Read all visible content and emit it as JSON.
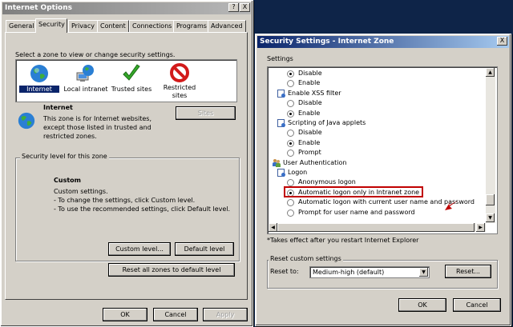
{
  "left_window": {
    "title": "Internet Options",
    "title_buttons": [
      "?",
      "X"
    ],
    "tabs": [
      "General",
      "Security",
      "Privacy",
      "Content",
      "Connections",
      "Programs",
      "Advanced"
    ],
    "zone_prompt": "Select a zone to view or change security settings.",
    "zones": [
      {
        "label": "Internet",
        "icon": "globe-icon"
      },
      {
        "label": "Local intranet",
        "icon": "intranet-icon"
      },
      {
        "label": "Trusted sites",
        "icon": "checkmark-icon"
      },
      {
        "label": "Restricted sites",
        "icon": "restricted-icon"
      }
    ],
    "zone_title": "Internet",
    "zone_desc": [
      "This zone is for Internet websites,",
      "except those listed in trusted and",
      "restricted zones."
    ],
    "sites_button": "Sites",
    "level_group_label": "Security level for this zone",
    "custom_title": "Custom",
    "custom_lines": [
      "Custom settings.",
      "- To change the settings, click Custom level.",
      "- To use the recommended settings, click Default level."
    ],
    "custom_level_button": "Custom level...",
    "default_level_button": "Default level",
    "reset_all_button": "Reset all zones to default level",
    "ok": "OK",
    "cancel": "Cancel",
    "apply": "Apply"
  },
  "right_window": {
    "title": "Security Settings - Internet Zone",
    "close": "X",
    "settings_label": "Settings",
    "items": [
      {
        "kind": "radio",
        "label": "Disable",
        "checked": true
      },
      {
        "kind": "radio",
        "label": "Enable",
        "checked": false
      },
      {
        "kind": "header",
        "label": "Enable XSS filter"
      },
      {
        "kind": "radio",
        "label": "Disable",
        "checked": false
      },
      {
        "kind": "radio",
        "label": "Enable",
        "checked": true
      },
      {
        "kind": "header",
        "label": "Scripting of Java applets"
      },
      {
        "kind": "radio",
        "label": "Disable",
        "checked": false
      },
      {
        "kind": "radio",
        "label": "Enable",
        "checked": true
      },
      {
        "kind": "radio",
        "label": "Prompt",
        "checked": false
      },
      {
        "kind": "category",
        "label": "User Authentication"
      },
      {
        "kind": "header",
        "label": "Logon"
      },
      {
        "kind": "radio",
        "label": "Anonymous logon",
        "checked": false
      },
      {
        "kind": "radio",
        "label": "Automatic logon only in Intranet zone",
        "checked": true
      },
      {
        "kind": "radio",
        "label": "Automatic logon with current user name and password",
        "checked": false
      },
      {
        "kind": "radio",
        "label": "Prompt for user name and password",
        "checked": false
      }
    ],
    "note": "*Takes effect after you restart Internet Explorer",
    "reset_group_label": "Reset custom settings",
    "reset_to_label": "Reset to:",
    "reset_select_value": "Medium-high (default)",
    "reset_button": "Reset...",
    "ok": "OK",
    "cancel": "Cancel",
    "highlight_color": "#c00000"
  }
}
